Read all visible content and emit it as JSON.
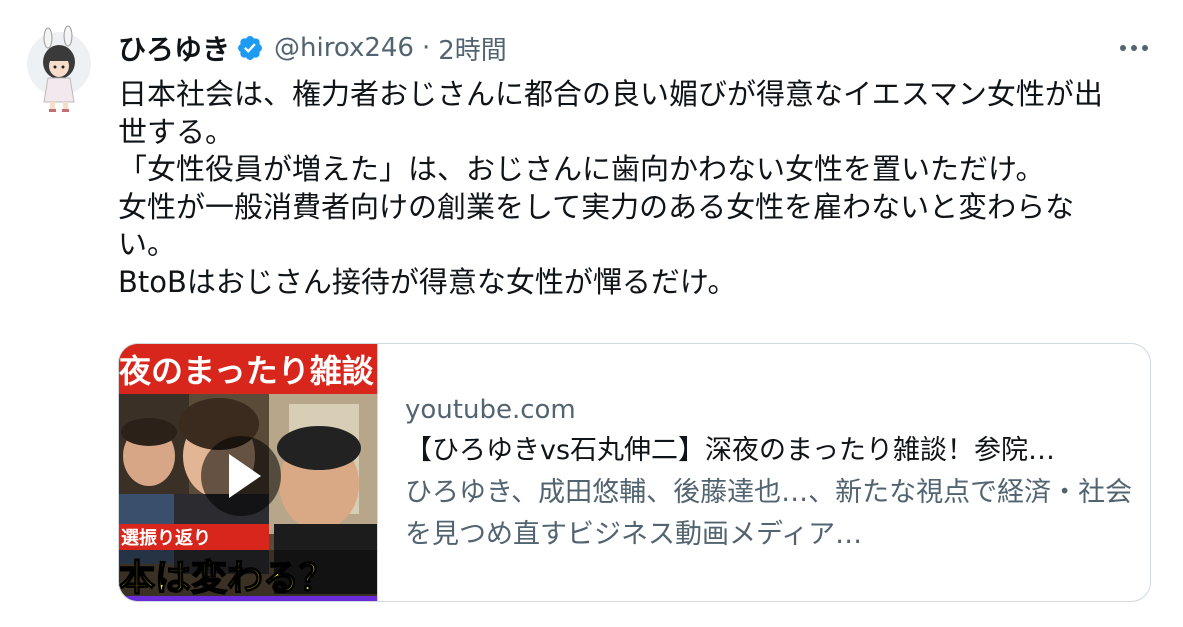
{
  "tweet": {
    "author": {
      "display_name": "ひろゆき",
      "handle": "@hirox246",
      "separator": "·",
      "time": "2時間",
      "verified_icon": "verified-badge-icon"
    },
    "more_icon": "more-options-icon",
    "lines": [
      "日本社会は、権力者おじさんに都合の良い媚びが得意なイエスマン女性が出",
      "世する。",
      "「女性役員が増えた」は、おじさんに歯向かわない女性を置いただけ。",
      "女性が一般消費者向けの創業をして実力のある女性を雇わないと変わらな",
      "い。",
      "BtoBはおじさん接待が得意な女性が憚るだけ。"
    ],
    "card": {
      "thumbnail_top_text": "夜のまったり雑談",
      "thumbnail_mid_text": "選振り返り",
      "thumbnail_bottom_text": "本は変わる？",
      "play_icon": "play-icon",
      "domain": "youtube.com",
      "title": "【ひろゆきvs石丸伸二】深夜のまったり雑談！参院…",
      "description": "ひろゆき、成田悠輔、後藤達也…、新たな視点で経済・社会を見つめ直すビジネス動画メディア…"
    },
    "colors": {
      "verified": "#1d9bf0",
      "text": "#0f1419",
      "secondary": "#536471",
      "border": "#cfd9de",
      "thumb_red": "#d8261c",
      "thumb_yellow": "#ffe600",
      "thumb_purple": "#6a2bd9"
    }
  }
}
